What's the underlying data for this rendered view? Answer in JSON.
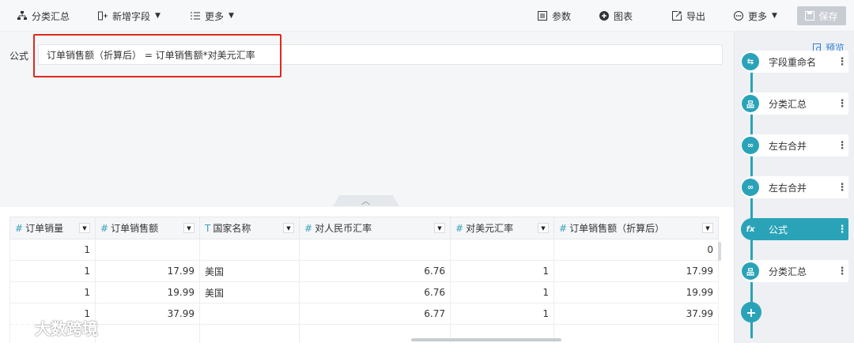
{
  "toolbar": {
    "group_summary": "分类汇总",
    "add_field": "新增字段",
    "more_left": "更多",
    "params": "参数",
    "chart": "图表",
    "export": "导出",
    "more_right": "更多",
    "save": "保存"
  },
  "formula": {
    "label": "公式",
    "expression": "订单销售额（折算后） = 订单销售额*对美元汇率"
  },
  "table": {
    "columns": [
      {
        "type_icon": "#",
        "name": "订单销量"
      },
      {
        "type_icon": "#",
        "name": "订单销售额"
      },
      {
        "type_icon": "T",
        "name": "国家名称"
      },
      {
        "type_icon": "#",
        "name": "对人民币汇率"
      },
      {
        "type_icon": "#",
        "name": "对美元汇率"
      },
      {
        "type_icon": "#",
        "name": "订单销售额（折算后）"
      }
    ],
    "rows": [
      [
        "1",
        "",
        "",
        "",
        "",
        "0"
      ],
      [
        "1",
        "17.99",
        "美国",
        "6.76",
        "1",
        "17.99"
      ],
      [
        "1",
        "19.99",
        "美国",
        "6.76",
        "1",
        "19.99"
      ],
      [
        "1",
        "37.99",
        "",
        "6.77",
        "1",
        "37.99"
      ],
      [
        "",
        "",
        "",
        "",
        "",
        ""
      ]
    ]
  },
  "panel": {
    "preview": "预览",
    "steps": [
      {
        "label": "字段重命名",
        "icon": "rename-icon",
        "active": false
      },
      {
        "label": "分类汇总",
        "icon": "group-icon",
        "active": false
      },
      {
        "label": "左右合并",
        "icon": "merge-icon",
        "active": false
      },
      {
        "label": "左右合并",
        "icon": "merge-icon",
        "active": false
      },
      {
        "label": "公式",
        "icon": "fx-icon",
        "active": true
      },
      {
        "label": "分类汇总",
        "icon": "group-icon",
        "active": false
      }
    ]
  },
  "watermark": "大数跨境",
  "colors": {
    "accent": "#2aa3b8",
    "highlight": "#e0281e",
    "link": "#2f7fd2"
  }
}
